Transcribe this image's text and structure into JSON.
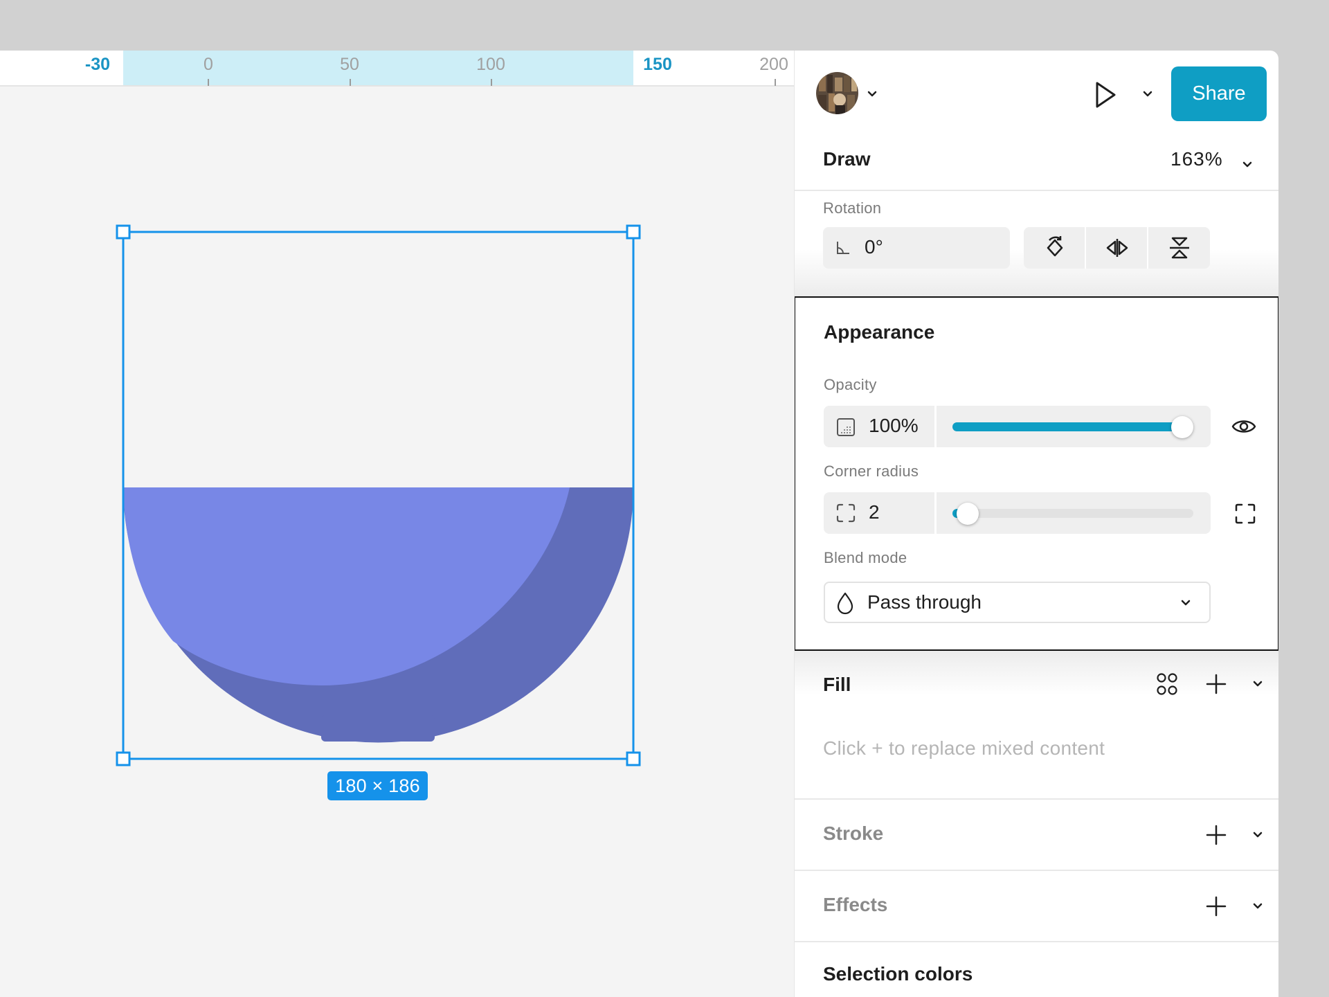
{
  "ruler": {
    "labels": [
      {
        "text": "-30",
        "highlight": true
      },
      {
        "text": "0",
        "highlight": false
      },
      {
        "text": "50",
        "highlight": false
      },
      {
        "text": "100",
        "highlight": false
      },
      {
        "text": "150",
        "highlight": true
      },
      {
        "text": "200",
        "highlight": false
      }
    ]
  },
  "canvas": {
    "selection_size": "180 × 186",
    "colors": {
      "bowl_light": "#7887e6",
      "bowl_dark": "#606dba",
      "selection": "#1592ea"
    }
  },
  "toolbar": {
    "share_label": "Share",
    "icons": [
      "avatar",
      "chevron-down-icon",
      "play-icon",
      "chevron-down-icon"
    ]
  },
  "mode": {
    "label": "Draw",
    "zoom": "163%"
  },
  "rotation": {
    "label": "Rotation",
    "value": "0°",
    "buttons": [
      "rotate-icon",
      "flip-horizontal-icon",
      "flip-vertical-icon"
    ]
  },
  "appearance": {
    "title": "Appearance",
    "opacity_label": "Opacity",
    "opacity_value": "100%",
    "opacity_fraction": 1.0,
    "corner_radius_label": "Corner radius",
    "corner_radius_value": "2",
    "corner_radius_fraction": 0.02,
    "blend_label": "Blend mode",
    "blend_value": "Pass through"
  },
  "fill": {
    "title": "Fill",
    "hint": "Click + to replace mixed content"
  },
  "stroke": {
    "title": "Stroke"
  },
  "effects": {
    "title": "Effects"
  },
  "selection_colors": {
    "title": "Selection colors"
  },
  "accent": "#0f9ec4"
}
